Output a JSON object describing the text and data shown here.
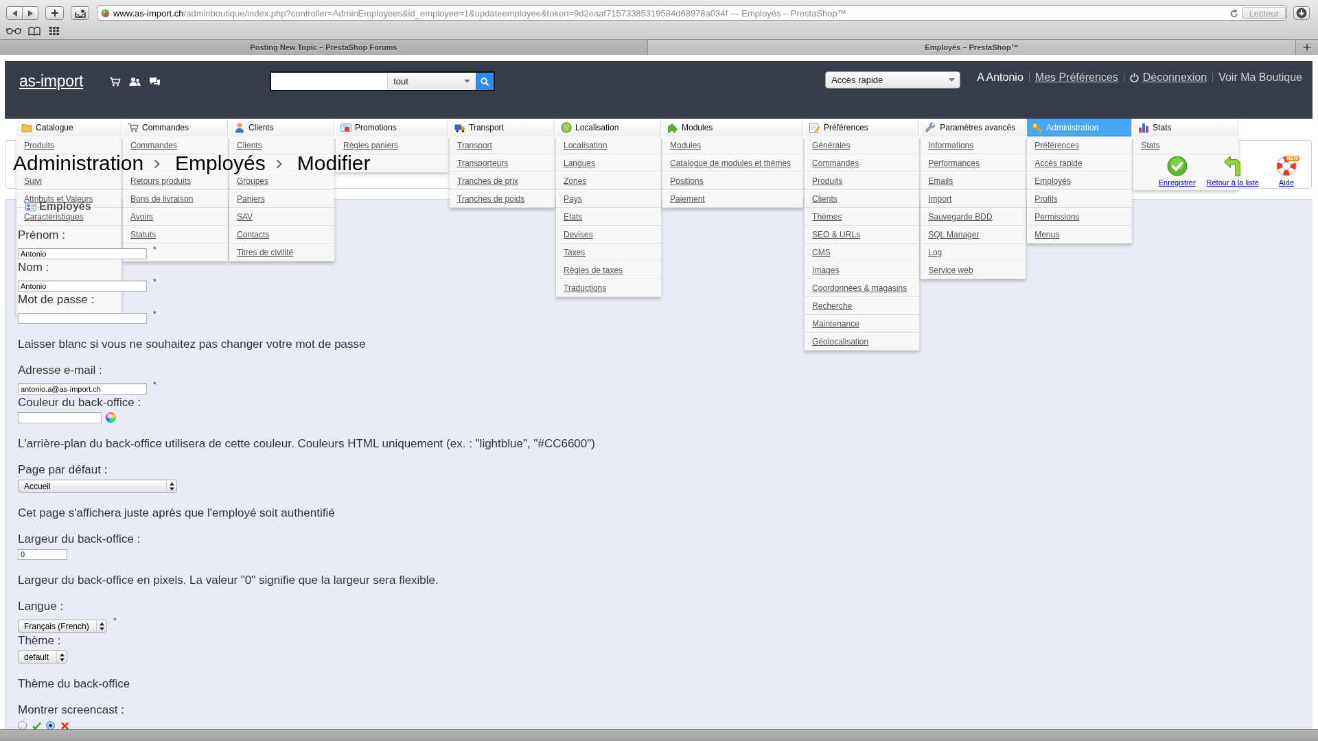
{
  "browser": {
    "address": {
      "host": "www.as-import.ch",
      "path": "/adminboutique/index.php?controller=AdminEmployees&id_employee=1&updateemployee&token=9d2eaaf71573385319584d68978a034f — Employés – PrestaShop™"
    },
    "reader_button": "Lecteur",
    "tabs": [
      {
        "title": "Posting New Topic – PrestaShop Forums",
        "selected": false
      },
      {
        "title": "Employés – PrestaShop™",
        "selected": true
      }
    ]
  },
  "header": {
    "logo": "as-import",
    "search": {
      "scope": "tout"
    },
    "quick_access": "Accès rapide",
    "user": "A Antonio",
    "links": [
      {
        "kind": "link",
        "label": "Mes Préférences"
      },
      {
        "kind": "logout",
        "label": "Déconnexion"
      },
      {
        "kind": "plain",
        "label": "Voir Ma Boutique"
      }
    ]
  },
  "menu": [
    {
      "label": "Catalogue",
      "selected": false,
      "items": [
        {
          "kind": "link",
          "label": "Produits"
        },
        {
          "kind": "covered"
        },
        {
          "kind": "link",
          "label": "Suivi"
        },
        {
          "kind": "link",
          "label": "Attributs et Valeurs"
        },
        {
          "kind": "link",
          "label": "Caractéristiques"
        },
        {
          "kind": "covered"
        },
        {
          "kind": "covered"
        },
        {
          "kind": "covered"
        },
        {
          "kind": "covered"
        },
        {
          "kind": "covered"
        }
      ]
    },
    {
      "label": "Commandes",
      "selected": false,
      "items": [
        {
          "kind": "link",
          "label": "Commandes"
        },
        {
          "kind": "covered"
        },
        {
          "kind": "link",
          "label": "Retours produits"
        },
        {
          "kind": "link",
          "label": "Bons de livraison"
        },
        {
          "kind": "link",
          "label": "Avoirs"
        },
        {
          "kind": "link",
          "label": "Statuts"
        },
        {
          "kind": "covered"
        }
      ]
    },
    {
      "label": "Clients",
      "selected": false,
      "items": [
        {
          "kind": "link",
          "label": "Clients"
        },
        {
          "kind": "covered"
        },
        {
          "kind": "link",
          "label": "Groupes"
        },
        {
          "kind": "link",
          "label": "Paniers"
        },
        {
          "kind": "link",
          "label": "SAV"
        },
        {
          "kind": "link",
          "label": "Contacts"
        },
        {
          "kind": "link",
          "label": "Titres de civilité"
        }
      ]
    },
    {
      "label": "Promotions",
      "selected": false,
      "items": [
        {
          "kind": "link",
          "label": "Règles paniers"
        },
        {
          "kind": "covered"
        }
      ]
    },
    {
      "label": "Transport",
      "selected": false,
      "items": [
        {
          "kind": "link",
          "label": "Transport"
        },
        {
          "kind": "link",
          "label": "Transporteurs"
        },
        {
          "kind": "link",
          "label": "Tranches de prix"
        },
        {
          "kind": "link",
          "label": "Tranches de poids"
        }
      ]
    },
    {
      "label": "Localisation",
      "selected": false,
      "items": [
        {
          "kind": "link",
          "label": "Localisation"
        },
        {
          "kind": "link",
          "label": "Langues"
        },
        {
          "kind": "link",
          "label": "Zones"
        },
        {
          "kind": "link",
          "label": "Pays"
        },
        {
          "kind": "link",
          "label": "Etats"
        },
        {
          "kind": "link",
          "label": "Devises"
        },
        {
          "kind": "link",
          "label": "Taxes"
        },
        {
          "kind": "link",
          "label": "Règles de taxes"
        },
        {
          "kind": "link",
          "label": "Traductions"
        }
      ]
    },
    {
      "label": "Modules",
      "selected": false,
      "items": [
        {
          "kind": "link",
          "label": "Modules"
        },
        {
          "kind": "link",
          "label": "Catalogue de modules et thèmes"
        },
        {
          "kind": "link",
          "label": "Positions"
        },
        {
          "kind": "link",
          "label": "Paiement"
        }
      ]
    },
    {
      "label": "Préférences",
      "selected": false,
      "items": [
        {
          "kind": "link",
          "label": "Générales"
        },
        {
          "kind": "link",
          "label": "Commandes"
        },
        {
          "kind": "link",
          "label": "Produits"
        },
        {
          "kind": "link",
          "label": "Clients"
        },
        {
          "kind": "link",
          "label": "Thèmes"
        },
        {
          "kind": "link",
          "label": "SEO & URLs"
        },
        {
          "kind": "link",
          "label": "CMS"
        },
        {
          "kind": "link",
          "label": "Images"
        },
        {
          "kind": "link",
          "label": "Coordonnées & magasins"
        },
        {
          "kind": "link",
          "label": "Recherche"
        },
        {
          "kind": "link",
          "label": "Maintenance"
        },
        {
          "kind": "link",
          "label": "Géolocalisation"
        }
      ]
    },
    {
      "label": "Paramètres avancés",
      "selected": false,
      "items": [
        {
          "kind": "link",
          "label": "Informations"
        },
        {
          "kind": "link",
          "label": "Performances"
        },
        {
          "kind": "link",
          "label": "Emails"
        },
        {
          "kind": "link",
          "label": "Import"
        },
        {
          "kind": "link",
          "label": "Sauvegarde BDD"
        },
        {
          "kind": "link",
          "label": "SQL Manager"
        },
        {
          "kind": "link",
          "label": "Log"
        },
        {
          "kind": "link",
          "label": "Service web"
        }
      ]
    },
    {
      "label": "Administration",
      "selected": true,
      "items": [
        {
          "kind": "link",
          "label": "Préférences"
        },
        {
          "kind": "link",
          "label": "Accès rapide"
        },
        {
          "kind": "link",
          "label": "Employés"
        },
        {
          "kind": "link",
          "label": "Profils"
        },
        {
          "kind": "link",
          "label": "Permissions"
        },
        {
          "kind": "link",
          "label": "Menus"
        }
      ]
    },
    {
      "label": "Stats",
      "selected": false,
      "items": [
        {
          "kind": "link",
          "label": "Stats"
        },
        {
          "kind": "covered"
        },
        {
          "kind": "covered"
        }
      ]
    }
  ],
  "title": {
    "breadcrumb": [
      "Administration",
      "Employés",
      "Modifier"
    ],
    "toolbar": [
      {
        "kind": "save",
        "label": "Enregistrer"
      },
      {
        "kind": "back",
        "label": "Retour à la liste"
      },
      {
        "kind": "help",
        "label": "Aide",
        "badge": "NEW"
      }
    ]
  },
  "section": {
    "title": "Employés"
  },
  "form": {
    "fields": [
      {
        "kind": "text",
        "label": "Prénom :",
        "value": "Antonio",
        "mark": "*"
      },
      {
        "kind": "text",
        "label": "Nom :",
        "value": "Antonio",
        "mark": "*"
      },
      {
        "kind": "password",
        "label": "Mot de passe :",
        "mark": "*",
        "hint": "Laisser blanc si vous ne souhaitez pas changer votre mot de passe"
      },
      {
        "kind": "text",
        "label": "Adresse e-mail :",
        "value": "antonio.a@as-import.ch",
        "mark": "*"
      },
      {
        "kind": "color",
        "label": "Couleur du back-office :",
        "hint": "L'arrière-plan du back-office utilisera de cette couleur. Couleurs HTML uniquement (ex. : \"lightblue\", \"#CC6600\")"
      },
      {
        "kind": "select",
        "label": "Page par défaut :",
        "value": "Accueil",
        "hint": "Cet page s'affichera juste après que l'employé soit authentifié"
      },
      {
        "kind": "text",
        "label": "Largeur du back-office :",
        "value": "0",
        "hint": "Largeur du back-office en pixels. La valeur \"0\" signifie que la largeur sera flexible."
      },
      {
        "kind": "select",
        "label": "Langue :",
        "value": "Français (French)",
        "mark": "*"
      },
      {
        "kind": "select",
        "label": "Thème :",
        "value": "default",
        "hint": "Thème du back-office"
      },
      {
        "kind": "radio",
        "label": "Montrer screencast :",
        "options": [
          {
            "kind": "yes",
            "selected": false
          },
          {
            "kind": "no",
            "selected": true
          }
        ]
      }
    ]
  }
}
